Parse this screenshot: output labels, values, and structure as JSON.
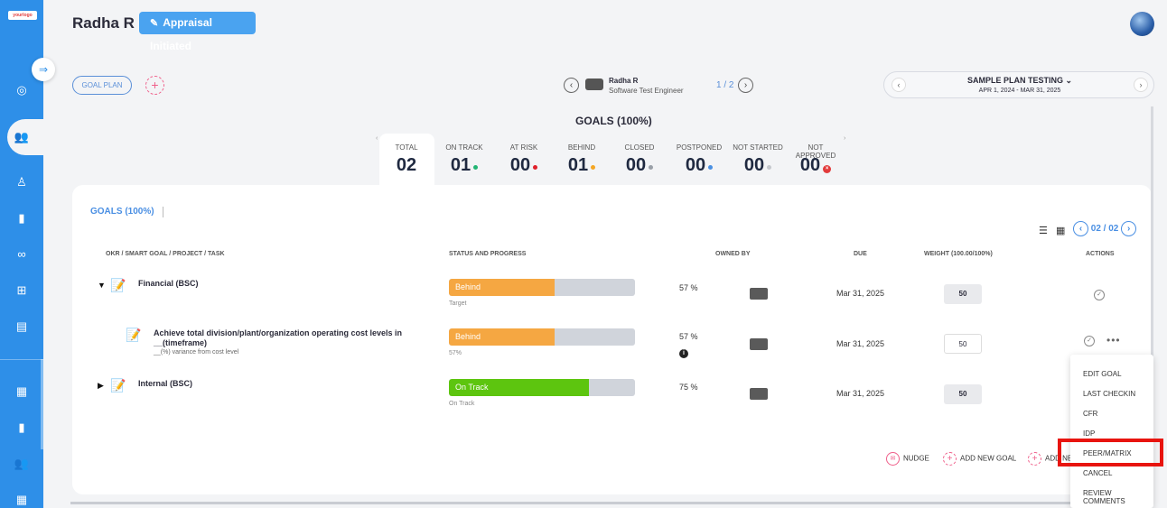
{
  "header": {
    "user_name": "Radha R",
    "appraisal_label": "Appraisal Initiated",
    "logo_text": "yourlogo"
  },
  "toolbar": {
    "goal_plan_label": "GOAL PLAN",
    "add_label": "+",
    "employee": {
      "name": "Radha R",
      "role": "Software Test Engineer"
    },
    "pager": "1 / 2",
    "plan": {
      "title": "SAMPLE PLAN TESTING",
      "dates": "APR 1, 2024 - MAR 31, 2025"
    }
  },
  "summary": {
    "heading": "GOALS (100%)",
    "stats": [
      {
        "label": "TOTAL",
        "value": "02",
        "dot": ""
      },
      {
        "label": "ON TRACK",
        "value": "01",
        "dot": "#22b573"
      },
      {
        "label": "AT RISK",
        "value": "00",
        "dot": "#e0202a"
      },
      {
        "label": "BEHIND",
        "value": "01",
        "dot": "#f5a623"
      },
      {
        "label": "CLOSED",
        "value": "00",
        "dot": "#9aa0a8"
      },
      {
        "label": "POSTPONED",
        "value": "00",
        "dot": "#4a90e2"
      },
      {
        "label": "NOT STARTED",
        "value": "00",
        "dot": "#c5c8cd"
      },
      {
        "label": "NOT APPROVED",
        "value": "00",
        "dot": "#e23b3b"
      }
    ]
  },
  "card": {
    "title": "GOALS (100%)",
    "pager": "02 / 02",
    "columns": {
      "goal": "OKR / SMART GOAL / PROJECT / TASK",
      "status": "STATUS AND PROGRESS",
      "owned": "OWNED BY",
      "due": "DUE",
      "weight": "WEIGHT (100.00/100%)",
      "actions": "ACTIONS"
    },
    "rows": [
      {
        "title": "Financial (BSC)",
        "subtitle": "",
        "status": "Behind",
        "caption": "Target",
        "progress": 57,
        "pct": "57 %",
        "due": "Mar 31, 2025",
        "weight": "50"
      },
      {
        "title": "Achieve total division/plant/organization operating cost levels in __(timeframe)",
        "subtitle": "__(%) variance from cost level",
        "status": "Behind",
        "caption": "57%",
        "progress": 57,
        "pct": "57 %",
        "due": "Mar 31, 2025",
        "weight": "50"
      },
      {
        "title": "Internal (BSC)",
        "subtitle": "",
        "status": "On Track",
        "caption": "On Track",
        "progress": 75,
        "pct": "75 %",
        "due": "Mar 31, 2025",
        "weight": "50"
      }
    ],
    "footer": {
      "nudge": "NUDGE",
      "add_goal": "ADD NEW GOAL",
      "add_partial": "ADD NE"
    }
  },
  "menu": {
    "items": [
      "EDIT GOAL",
      "LAST CHECKIN",
      "CFR",
      "IDP",
      "PEER/MATRIX",
      "CANCEL",
      "REVIEW COMMENTS"
    ],
    "highlighted": "PEER/MATRIX"
  },
  "colors": {
    "sidebar": "#2e8fe8",
    "behind": "#f5a742",
    "on_track": "#5dc50f",
    "accent": "#4a8fe3",
    "highlight_box": "#e8140f"
  }
}
